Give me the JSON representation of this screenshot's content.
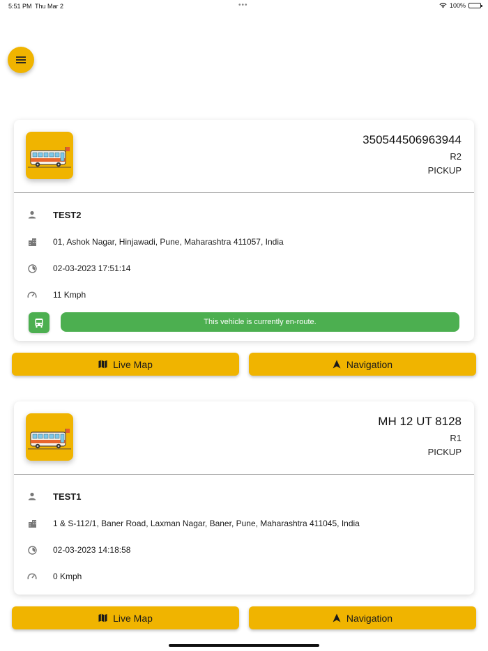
{
  "status_bar": {
    "time": "5:51 PM",
    "date": "Thu Mar 2",
    "dots": "•••",
    "battery": "100%"
  },
  "menu": {
    "icon": "hamburger-icon"
  },
  "vehicles": [
    {
      "vehicle_id": "350544506963944",
      "route": "R2",
      "trip_type": "PICKUP",
      "driver": "TEST2",
      "address": "01, Ashok Nagar, Hinjawadi, Pune, Maharashtra 411057, India",
      "timestamp": "02-03-2023 17:51:14",
      "speed": "11 Kmph",
      "status_message": "This vehicle is currently en-route."
    },
    {
      "vehicle_id": "MH 12 UT 8128",
      "route": "R1",
      "trip_type": "PICKUP",
      "driver": "TEST1",
      "address": "1 & S-112/1, Baner Road, Laxman Nagar, Baner, Pune, Maharashtra 411045, India",
      "timestamp": "02-03-2023 14:18:58",
      "speed": "0 Kmph"
    }
  ],
  "buttons": {
    "live_map": "Live Map",
    "navigation": "Navigation"
  },
  "colors": {
    "accent": "#f0b400",
    "status_green": "#4caf50"
  }
}
